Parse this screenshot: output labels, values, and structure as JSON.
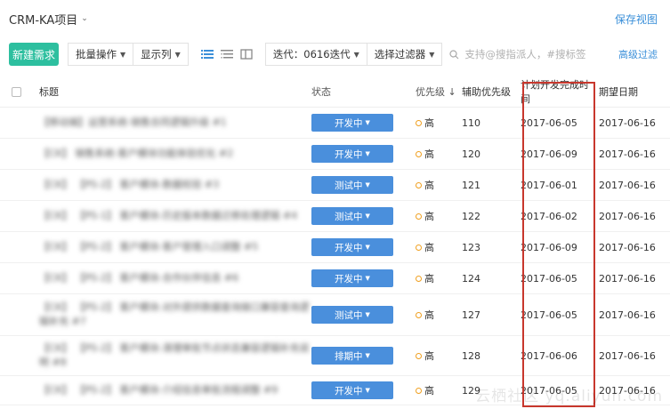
{
  "header": {
    "project_title": "CRM-KA项目",
    "save_view": "保存视图"
  },
  "toolbar": {
    "new_button": "新建需求",
    "bulk_ops": "批量操作",
    "show_columns": "显示列",
    "iteration": "迭代：0616迭代",
    "filter_select": "选择过滤器",
    "search_placeholder": "支持@搜指派人，#搜标签",
    "advanced_filter": "高级过滤"
  },
  "table": {
    "columns": {
      "title": "标题",
      "status": "状态",
      "priority": "优先级",
      "priority_sort": "↓",
      "aux_priority": "辅助优先级",
      "planned_date": "计划开发完成时间",
      "expected_date": "期望日期"
    },
    "rows": [
      {
        "title": "【移动端】运营系统-销售合同逻辑升级 #1",
        "status": "开发中",
        "priority": "高",
        "aux": "110",
        "planned": "2017-06-05",
        "expected": "2017-06-16"
      },
      {
        "title": "【CK】 销售系统-客户模块功能体验优化 #2",
        "status": "开发中",
        "priority": "高",
        "aux": "120",
        "planned": "2017-06-09",
        "expected": "2017-06-16"
      },
      {
        "title": "【CK】 【PS-2】 客户模块-数据校验 #3",
        "status": "测试中",
        "priority": "高",
        "aux": "121",
        "planned": "2017-06-01",
        "expected": "2017-06-16"
      },
      {
        "title": "【CK】 【PS-1】 客户模块-历史版本数据迁移处理逻辑 #4",
        "status": "测试中",
        "priority": "高",
        "aux": "122",
        "planned": "2017-06-02",
        "expected": "2017-06-16"
      },
      {
        "title": "【CK】 【PS-2】 客户模块-客户管理入口调整 #5",
        "status": "开发中",
        "priority": "高",
        "aux": "123",
        "planned": "2017-06-09",
        "expected": "2017-06-16"
      },
      {
        "title": "【CK】 【PS-2】 客户模块-合作伙伴信息 #6",
        "status": "开发中",
        "priority": "高",
        "aux": "124",
        "planned": "2017-06-05",
        "expected": "2017-06-16"
      },
      {
        "title": "【CK】 【PS-2】 客户模块-对外提供数据查询接口兼容查询逻辑补充 #7",
        "status": "测试中",
        "priority": "高",
        "aux": "127",
        "planned": "2017-06-05",
        "expected": "2017-06-16"
      },
      {
        "title": "【CK】 【PS-2】 客户模块-清理审批节点状态兼容逻辑补充说明 #8",
        "status": "排期中",
        "priority": "高",
        "aux": "128",
        "planned": "2017-06-06",
        "expected": "2017-06-16"
      },
      {
        "title": "【CK】 【PS-2】 客户模块-介绍信息审批流程调整 #9",
        "status": "开发中",
        "priority": "高",
        "aux": "129",
        "planned": "2017-06-05",
        "expected": "2017-06-16"
      }
    ]
  },
  "watermark": "云栖社区 yq.aliyun.com",
  "colors": {
    "accent_green": "#2dbf9f",
    "status_blue": "#4a8fdc",
    "link_blue": "#3a8fd9",
    "priority_orange": "#f0a020",
    "highlight_red": "#c8372d"
  }
}
